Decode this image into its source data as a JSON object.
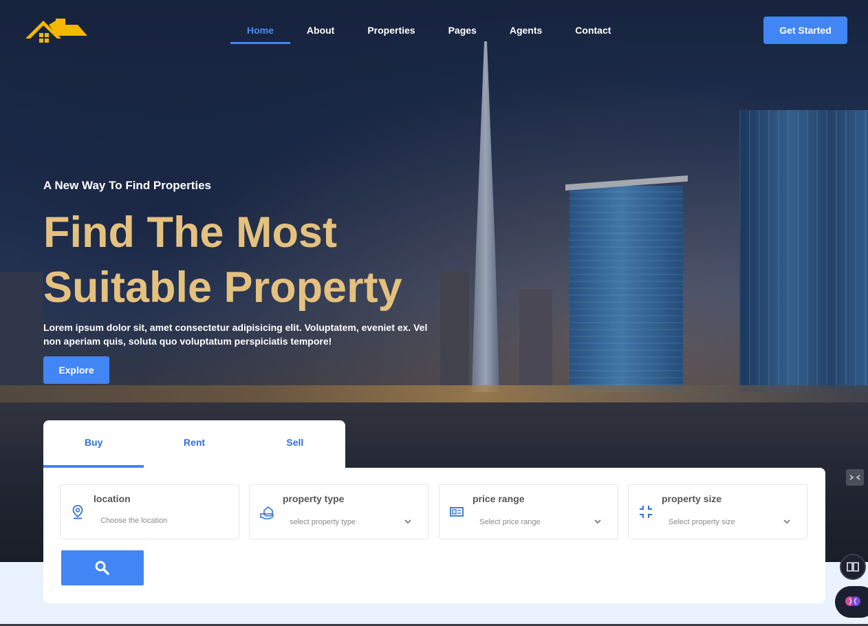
{
  "nav": {
    "items": [
      {
        "label": "Home",
        "active": true
      },
      {
        "label": "About",
        "active": false
      },
      {
        "label": "Properties",
        "active": false
      },
      {
        "label": "Pages",
        "active": false
      },
      {
        "label": "Agents",
        "active": false
      },
      {
        "label": "Contact",
        "active": false
      }
    ],
    "cta_label": "Get Started"
  },
  "hero": {
    "tagline": "A New Way To Find Properties",
    "headline": "Find The Most Suitable Property",
    "description": "Lorem ipsum dolor sit, amet consectetur adipisicing elit. Voluptatem, eveniet ex. Vel non aperiam quis, soluta quo voluptatum perspiciatis tempore!",
    "explore_label": "Explore"
  },
  "search": {
    "tabs": [
      {
        "label": "Buy",
        "active": true
      },
      {
        "label": "Rent",
        "active": false
      },
      {
        "label": "Sell",
        "active": false
      }
    ],
    "fields": [
      {
        "label": "location",
        "placeholder": "Choose the location",
        "icon": "location-pin-icon"
      },
      {
        "label": "property type",
        "placeholder": "select property type",
        "icon": "house-hand-icon"
      },
      {
        "label": "price range",
        "placeholder": "Select price range",
        "icon": "price-tag-icon"
      },
      {
        "label": "property size",
        "placeholder": "Select property size",
        "icon": "resize-icon"
      }
    ]
  },
  "colors": {
    "accent": "#4285f4",
    "headline": "#e4c17f",
    "logo": "#f5b800"
  }
}
